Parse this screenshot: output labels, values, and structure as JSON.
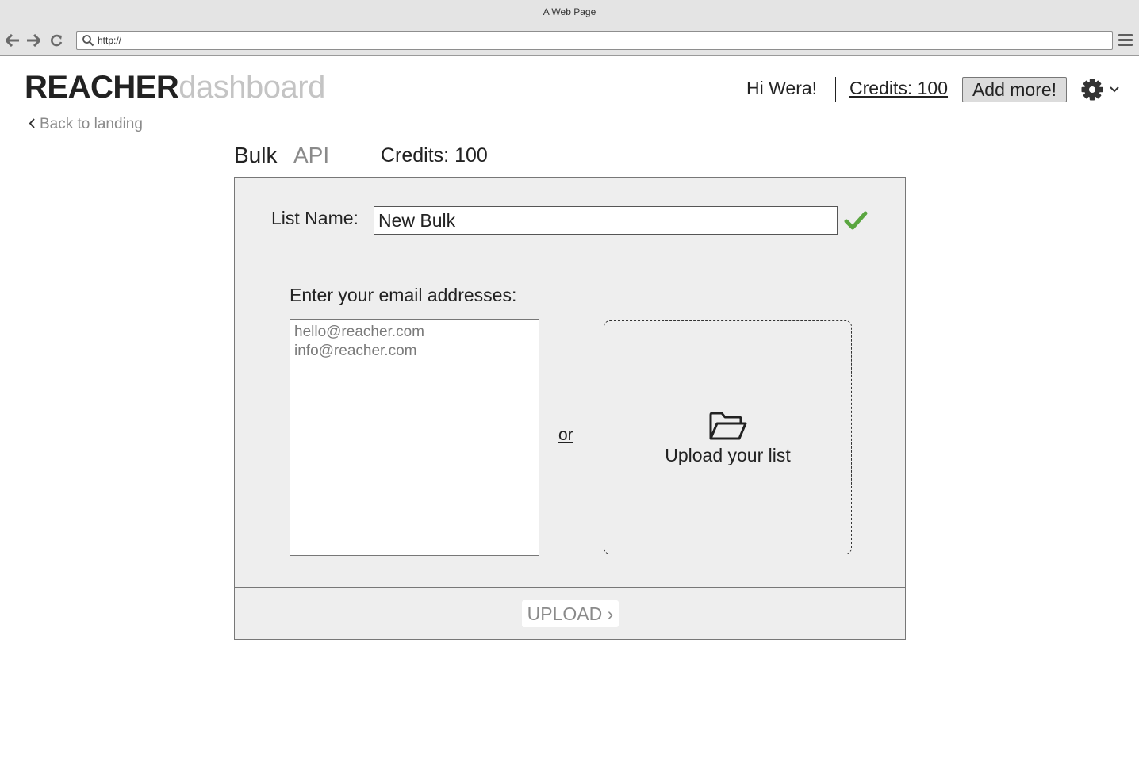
{
  "browser": {
    "title": "A Web Page",
    "url": "http://"
  },
  "header": {
    "brand_primary": "REACHER",
    "brand_secondary": "dashboard",
    "back_link": "Back to landing",
    "greeting": "Hi Wera!",
    "credits_link": "Credits: 100",
    "add_more_label": "Add more!"
  },
  "tabs": {
    "bulk": "Bulk",
    "api": "API",
    "credits": "Credits: 100"
  },
  "form": {
    "list_name_label": "List Name:",
    "list_name_value": "New Bulk",
    "emails_label": "Enter your email addresses:",
    "emails_value": "hello@reacher.com\ninfo@reacher.com",
    "or_label": "or",
    "upload_list_label": "Upload your list",
    "upload_button_label": "UPLOAD ›"
  },
  "colors": {
    "check_green": "#5aa640",
    "muted_gray": "#8a8a8a",
    "panel_bg": "#eeeeee"
  },
  "icons": {
    "back": "chevron-left-icon",
    "forward": "arrow-right-icon",
    "reload": "reload-icon",
    "search": "search-icon",
    "menu": "hamburger-icon",
    "settings": "gear-icon",
    "dropdown": "chevron-down-icon",
    "valid": "checkmark-icon",
    "upload": "folder-open-icon"
  }
}
